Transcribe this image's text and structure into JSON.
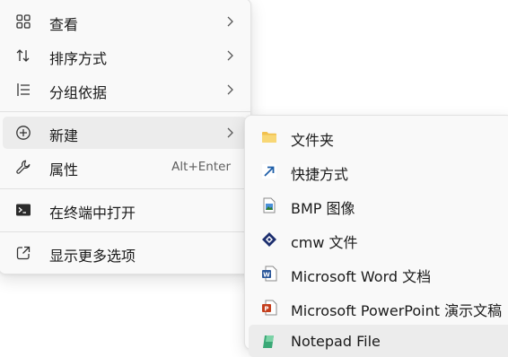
{
  "context_menu": {
    "items": [
      {
        "label": "查看",
        "icon": "grid-view-icon",
        "has_submenu": true
      },
      {
        "label": "排序方式",
        "icon": "sort-icon",
        "has_submenu": true
      },
      {
        "label": "分组依据",
        "icon": "group-list-icon",
        "has_submenu": true
      },
      {
        "label": "新建",
        "icon": "plus-circle-icon",
        "has_submenu": true,
        "highlighted": true
      },
      {
        "label": "属性",
        "icon": "wrench-icon",
        "shortcut": "Alt+Enter"
      },
      {
        "label": "在终端中打开",
        "icon": "terminal-icon"
      },
      {
        "label": "显示更多选项",
        "icon": "external-link-icon"
      }
    ]
  },
  "new_submenu": {
    "items": [
      {
        "label": "文件夹",
        "icon": "folder-icon"
      },
      {
        "label": "快捷方式",
        "icon": "shortcut-arrow-icon"
      },
      {
        "label": "BMP 图像",
        "icon": "bmp-image-icon"
      },
      {
        "label": "cmw 文件",
        "icon": "cmw-file-icon"
      },
      {
        "label": "Microsoft Word 文档",
        "icon": "word-doc-icon"
      },
      {
        "label": "Microsoft PowerPoint 演示文稿",
        "icon": "powerpoint-icon"
      },
      {
        "label": "Notepad File",
        "icon": "notepad-file-icon",
        "highlighted": true
      }
    ]
  },
  "colors": {
    "menu_bg": "#f9f9f9",
    "hover_bg": "#ececec",
    "text": "#1a1a1a",
    "shortcut_text": "#5f5f5f",
    "folder": "#f2c14e",
    "word_blue": "#2b579a",
    "powerpoint_orange": "#c43e1c",
    "notepad_green": "#3aa876"
  }
}
